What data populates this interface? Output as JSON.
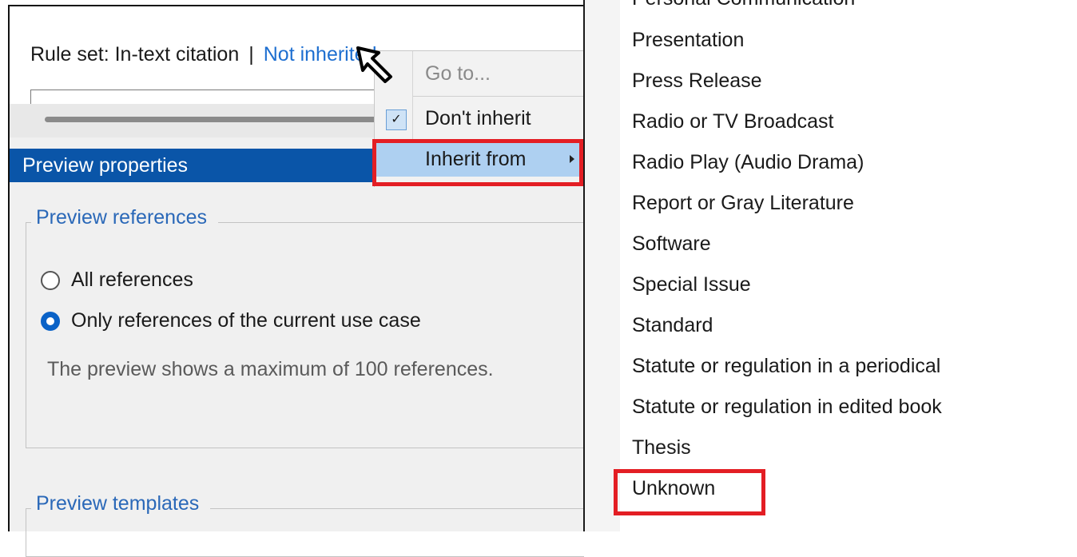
{
  "rule_set": {
    "label": "Rule set: In-text citation",
    "separator": "|",
    "inheritance_link": "Not inherited"
  },
  "preview_panel": {
    "header": "Preview properties",
    "references_group": {
      "title": "Preview references",
      "options": [
        {
          "label": "All references",
          "selected": false
        },
        {
          "label": "Only references of the current use case",
          "selected": true
        }
      ],
      "note": "The preview shows a maximum of 100 references."
    },
    "templates_group": {
      "title": "Preview templates"
    }
  },
  "context_menu": {
    "items": [
      {
        "label": "Go to...",
        "enabled": false,
        "checked": false
      },
      {
        "label": "Don't inherit",
        "enabled": true,
        "checked": true
      },
      {
        "label": "Inherit from",
        "enabled": true,
        "checked": false,
        "has_submenu": true,
        "highlighted": true
      }
    ],
    "check_glyph": "✓"
  },
  "submenu": {
    "items": [
      "Personal Communication",
      "Presentation",
      "Press Release",
      "Radio or TV Broadcast",
      "Radio Play (Audio Drama)",
      "Report or Gray Literature",
      "Software",
      "Special Issue",
      "Standard",
      "Statute or regulation in a periodical",
      "Statute or regulation in edited book",
      "Thesis",
      "Unknown"
    ]
  },
  "colors": {
    "accent": "#0a55a8",
    "link": "#1e6fd0",
    "highlight": "#aed0f1",
    "annotation_red": "#e31e24"
  }
}
